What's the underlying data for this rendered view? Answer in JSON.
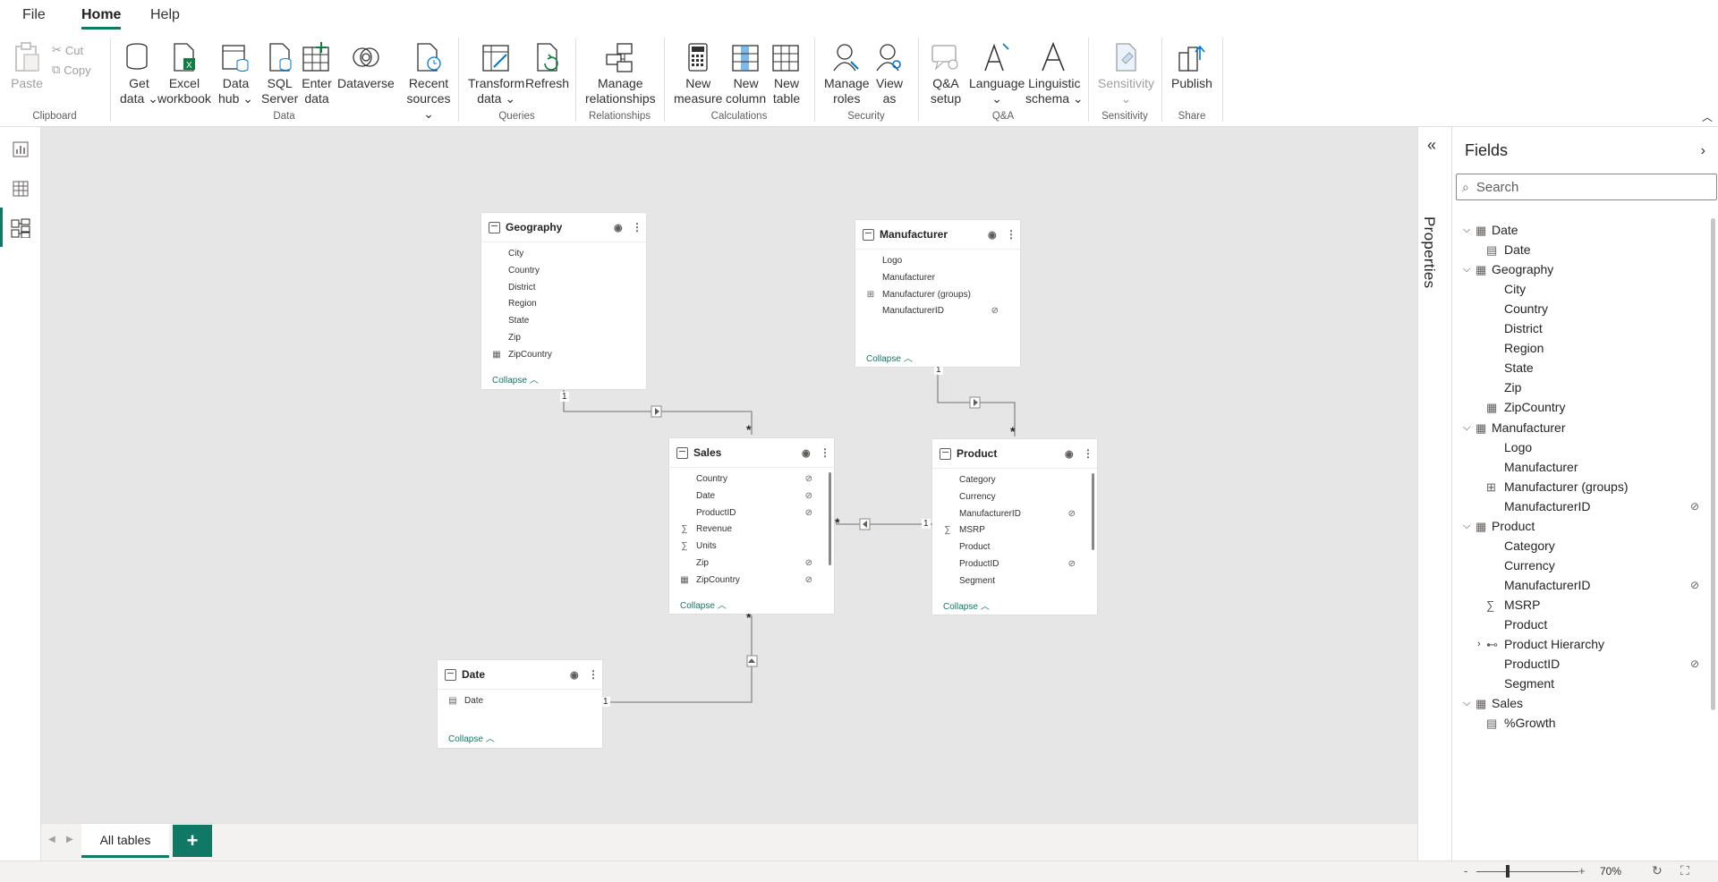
{
  "menu": {
    "file": "File",
    "home": "Home",
    "help": "Help"
  },
  "ribbon": {
    "clipboard": {
      "label": "Clipboard",
      "paste": "Paste",
      "cut": "Cut",
      "copy": "Copy"
    },
    "data": {
      "label": "Data",
      "get_data": [
        "Get",
        "data"
      ],
      "excel": [
        "Excel",
        "workbook"
      ],
      "hub": [
        "Data",
        "hub"
      ],
      "sql": [
        "SQL",
        "Server"
      ],
      "enter": [
        "Enter",
        "data"
      ],
      "dataverse": "Dataverse",
      "recent": [
        "Recent",
        "sources"
      ]
    },
    "queries": {
      "label": "Queries",
      "transform": [
        "Transform",
        "data"
      ],
      "refresh": "Refresh"
    },
    "relationships": {
      "label": "Relationships",
      "manage": [
        "Manage",
        "relationships"
      ]
    },
    "calculations": {
      "label": "Calculations",
      "measure": [
        "New",
        "measure"
      ],
      "column": [
        "New",
        "column"
      ],
      "table": [
        "New",
        "table"
      ]
    },
    "security": {
      "label": "Security",
      "roles": [
        "Manage",
        "roles"
      ],
      "viewas": [
        "View",
        "as"
      ]
    },
    "qa": {
      "label": "Q&A",
      "setup": [
        "Q&A",
        "setup"
      ],
      "language": "Language",
      "schema": [
        "Linguistic",
        "schema"
      ]
    },
    "sensitivity": {
      "label": "Sensitivity",
      "btn": "Sensitivity"
    },
    "share": {
      "label": "Share",
      "publish": "Publish"
    }
  },
  "tables": {
    "geography": {
      "name": "Geography",
      "fields": [
        "City",
        "Country",
        "District",
        "Region",
        "State",
        "Zip",
        "ZipCountry"
      ],
      "collapse": "Collapse"
    },
    "manufacturer": {
      "name": "Manufacturer",
      "fields": [
        "Logo",
        "Manufacturer",
        "Manufacturer (groups)",
        "ManufacturerID"
      ],
      "collapse": "Collapse"
    },
    "sales": {
      "name": "Sales",
      "fields": [
        "Country",
        "Date",
        "ProductID",
        "Revenue",
        "Units",
        "Zip",
        "ZipCountry"
      ],
      "collapse": "Collapse"
    },
    "product": {
      "name": "Product",
      "fields": [
        "Category",
        "Currency",
        "ManufacturerID",
        "MSRP",
        "Product",
        "ProductID",
        "Segment"
      ],
      "collapse": "Collapse"
    },
    "date": {
      "name": "Date",
      "fields": [
        "Date"
      ],
      "collapse": "Collapse"
    }
  },
  "relationships": {
    "one": "1",
    "many": "*"
  },
  "bottom": {
    "tab_all": "All tables",
    "add": "+"
  },
  "status": {
    "zoom": "70%",
    "minus": "-",
    "plus": "+"
  },
  "properties": {
    "label": "Properties"
  },
  "fields_pane": {
    "title": "Fields",
    "search_placeholder": "Search",
    "items": [
      {
        "label": "Date",
        "kind": "table-date",
        "level": 0
      },
      {
        "label": "Date",
        "kind": "date",
        "level": 1
      },
      {
        "label": "Geography",
        "kind": "table",
        "level": 0
      },
      {
        "label": "City",
        "kind": "field",
        "level": 1
      },
      {
        "label": "Country",
        "kind": "field",
        "level": 1
      },
      {
        "label": "District",
        "kind": "field",
        "level": 1
      },
      {
        "label": "Region",
        "kind": "field",
        "level": 1
      },
      {
        "label": "State",
        "kind": "field",
        "level": 1
      },
      {
        "label": "Zip",
        "kind": "field",
        "level": 1
      },
      {
        "label": "ZipCountry",
        "kind": "calc",
        "level": 1
      },
      {
        "label": "Manufacturer",
        "kind": "table",
        "level": 0
      },
      {
        "label": "Logo",
        "kind": "field",
        "level": 1
      },
      {
        "label": "Manufacturer",
        "kind": "field",
        "level": 1
      },
      {
        "label": "Manufacturer (groups)",
        "kind": "group",
        "level": 1
      },
      {
        "label": "ManufacturerID",
        "kind": "field",
        "level": 1,
        "hidden": true
      },
      {
        "label": "Product",
        "kind": "table",
        "level": 0
      },
      {
        "label": "Category",
        "kind": "field",
        "level": 1
      },
      {
        "label": "Currency",
        "kind": "field",
        "level": 1
      },
      {
        "label": "ManufacturerID",
        "kind": "field",
        "level": 1,
        "hidden": true
      },
      {
        "label": "MSRP",
        "kind": "sigma",
        "level": 1
      },
      {
        "label": "Product",
        "kind": "field",
        "level": 1
      },
      {
        "label": "Product Hierarchy",
        "kind": "hierarchy",
        "level": 1
      },
      {
        "label": "ProductID",
        "kind": "field",
        "level": 1,
        "hidden": true
      },
      {
        "label": "Segment",
        "kind": "field",
        "level": 1
      },
      {
        "label": "Sales",
        "kind": "table",
        "level": 0
      },
      {
        "label": "%Growth",
        "kind": "measure",
        "level": 1
      }
    ]
  }
}
